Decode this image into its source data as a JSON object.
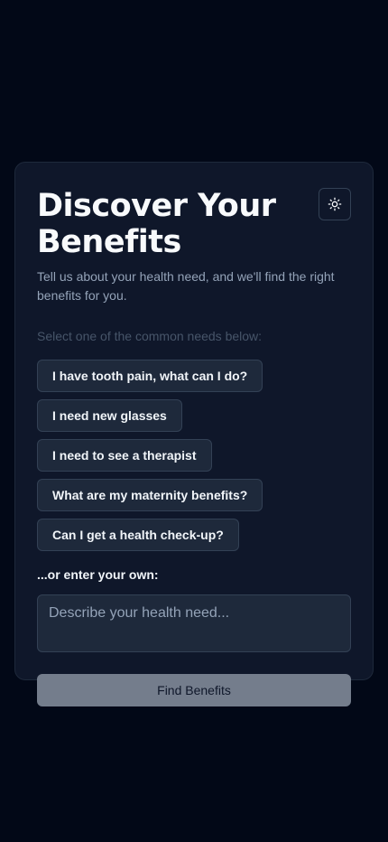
{
  "header": {
    "title": "Discover Your Benefits",
    "subtitle": "Tell us about your health need, and we'll find the right benefits for you.",
    "theme_toggle_icon": "sun-icon"
  },
  "suggestions": {
    "label": "Select one of the common needs below:",
    "items": [
      {
        "label": "I have tooth pain, what can I do?"
      },
      {
        "label": "I need new glasses"
      },
      {
        "label": "I need to see a therapist"
      },
      {
        "label": "What are my maternity benefits?"
      },
      {
        "label": "Can I get a health check-up?"
      }
    ]
  },
  "custom": {
    "label": "...or enter your own:",
    "placeholder": "Describe your health need...",
    "value": ""
  },
  "submit": {
    "label": "Find Benefits"
  },
  "colors": {
    "background": "#020817",
    "card": "#0f172a",
    "button_disabled": "#747d8c"
  }
}
